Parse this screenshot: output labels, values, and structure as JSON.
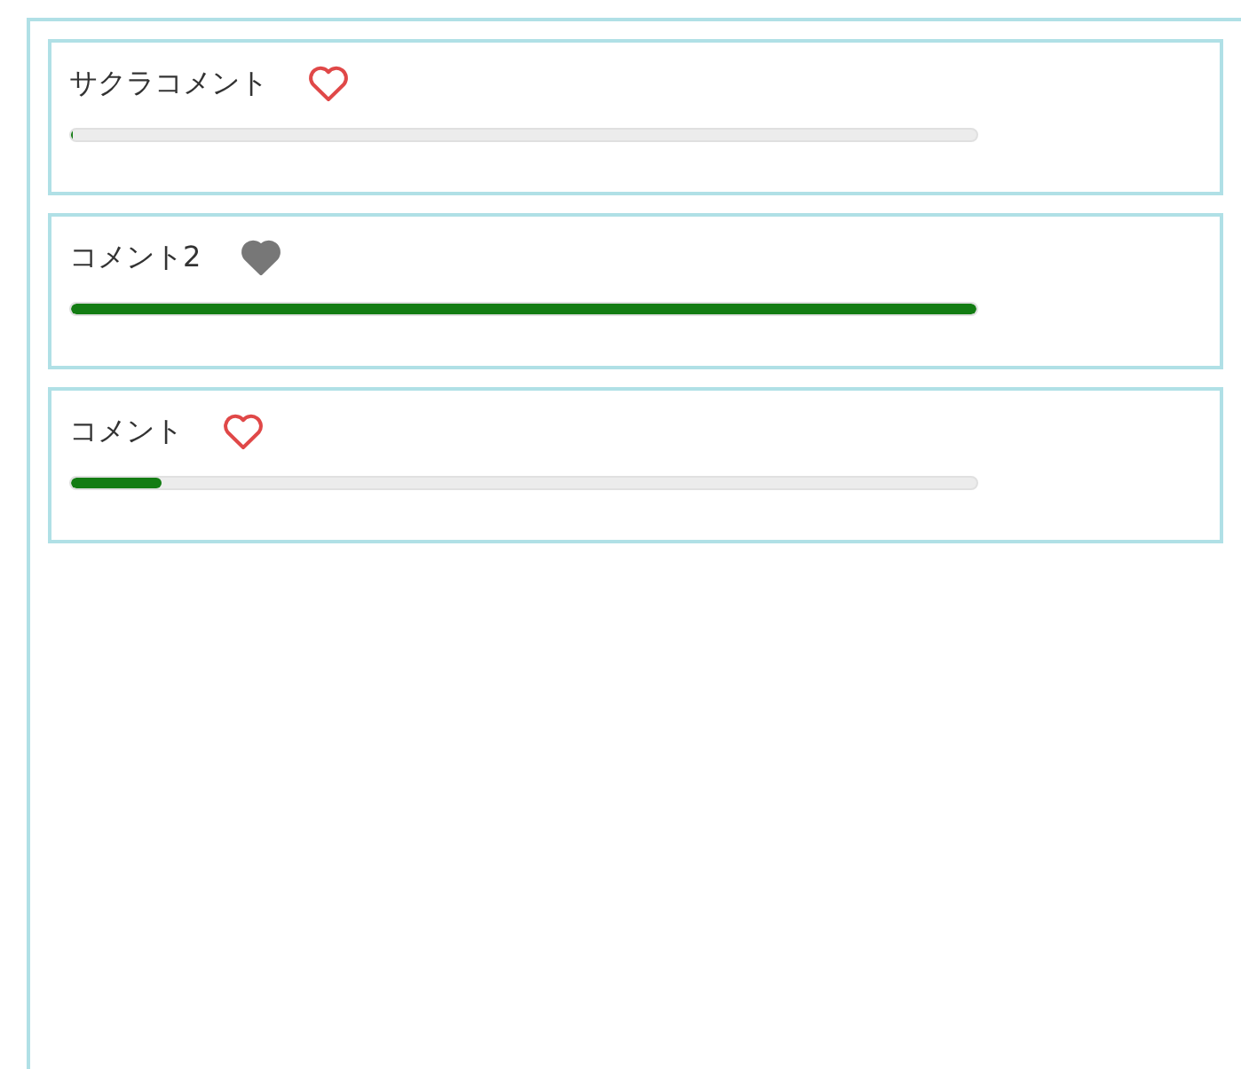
{
  "comments": [
    {
      "text": "サクラコメント",
      "liked": false,
      "level": 0
    },
    {
      "text": "コメント2",
      "liked": true,
      "level": 1
    },
    {
      "text": "コメント",
      "liked": false,
      "level": 0.1
    }
  ]
}
